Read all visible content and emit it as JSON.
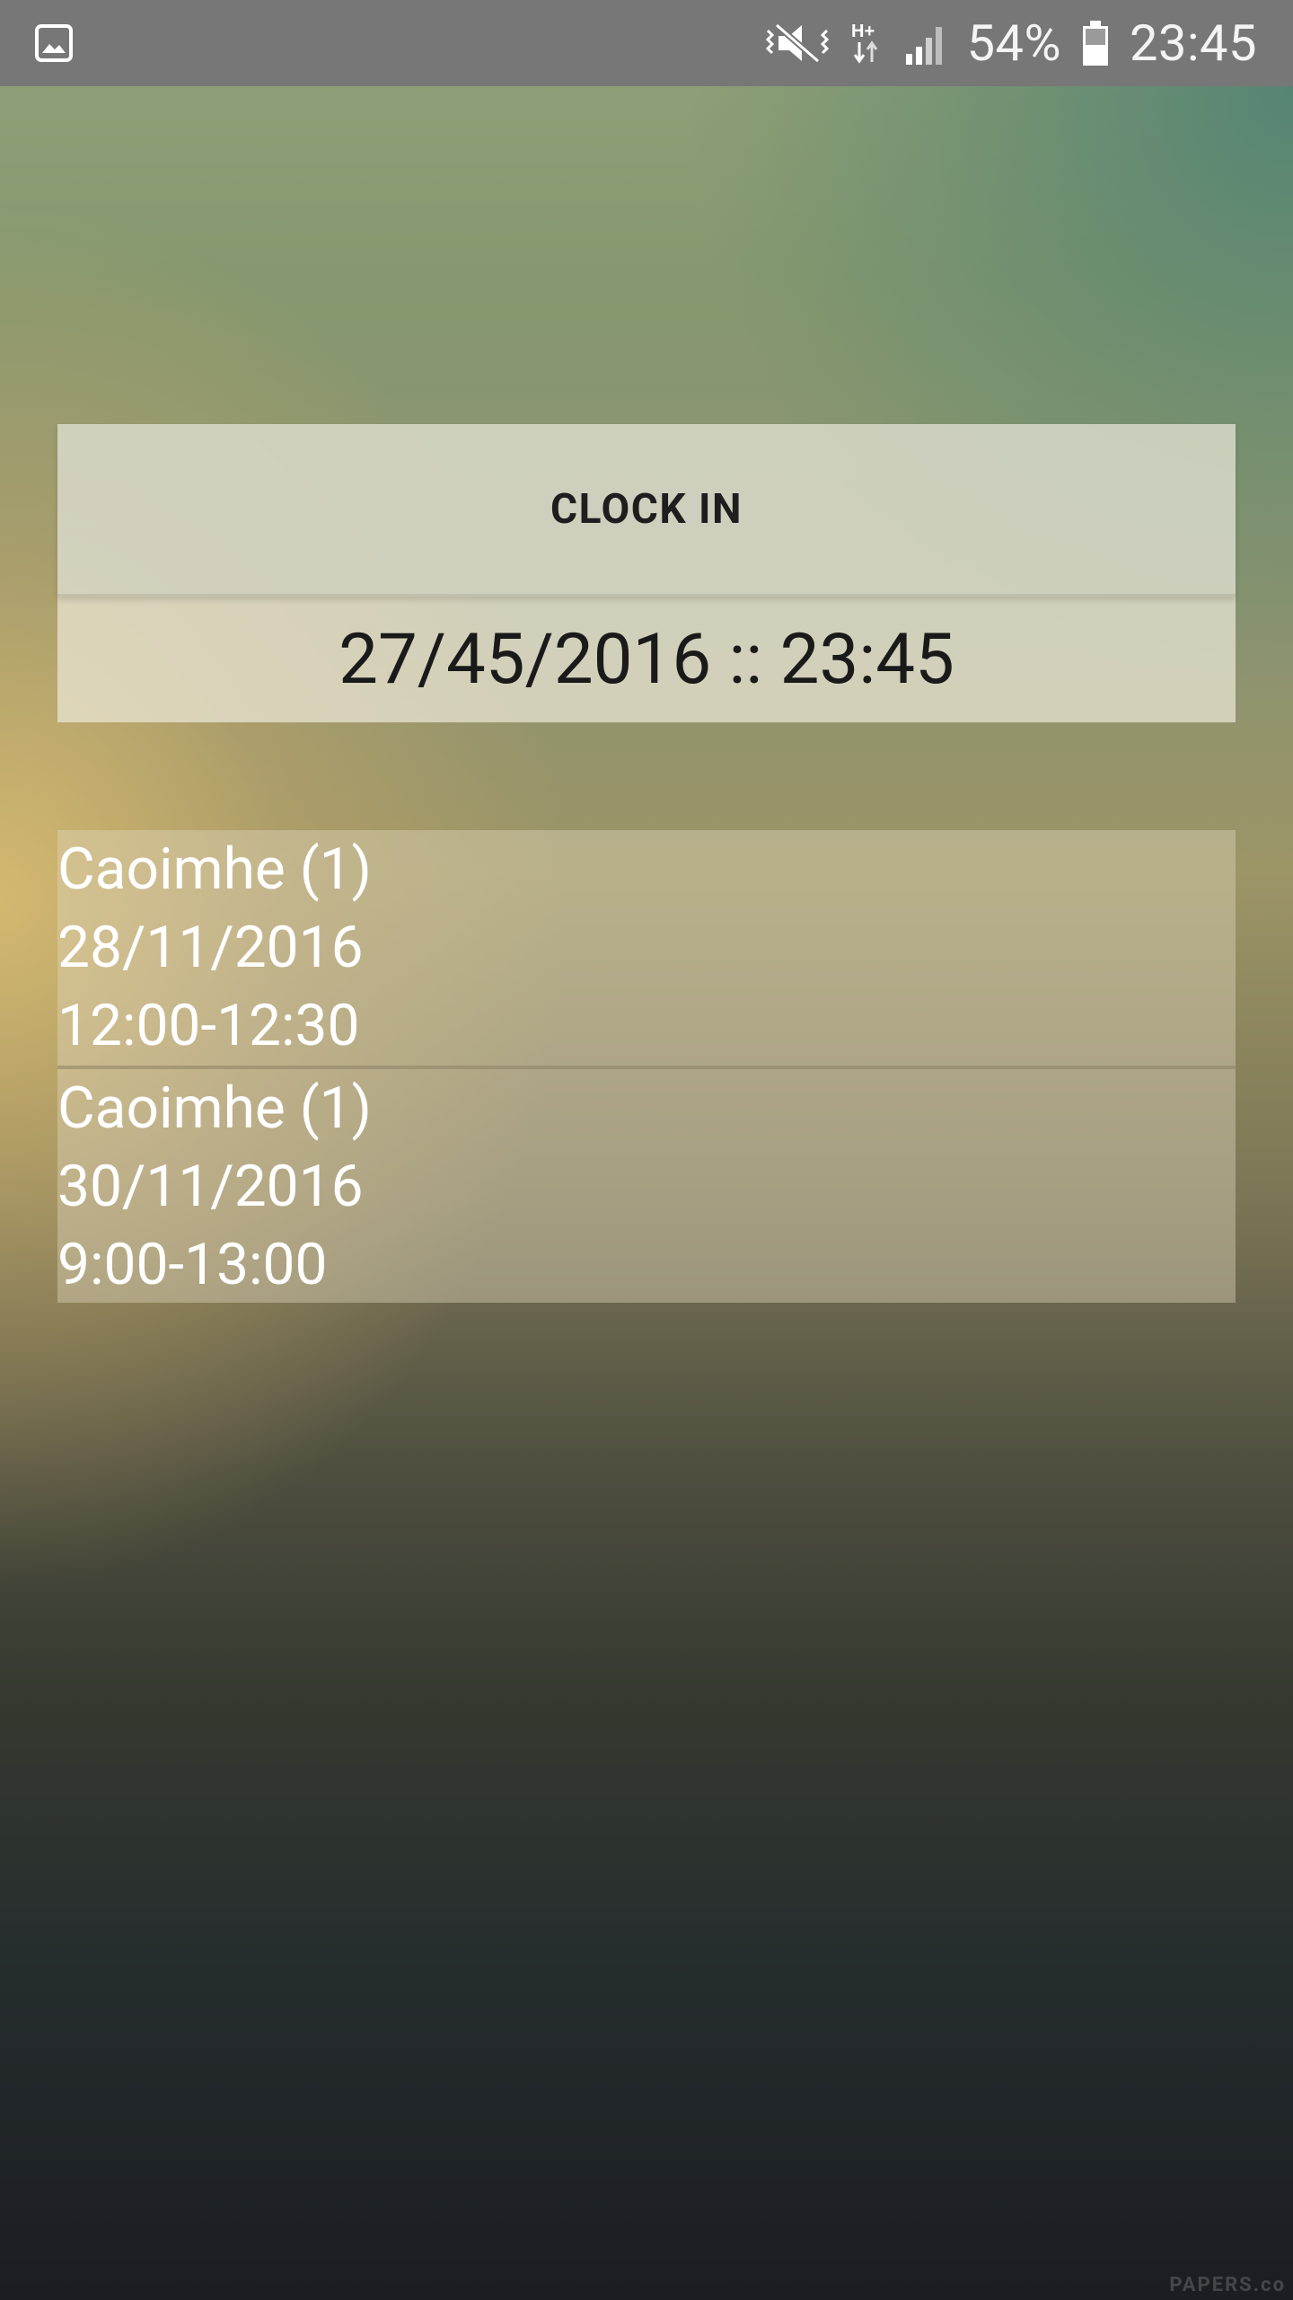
{
  "status_bar": {
    "battery_percent": "54%",
    "time": "23:45",
    "icons": [
      "image-icon",
      "vibrate-mute-icon",
      "network-hplus-icon",
      "signal-icon",
      "battery-icon"
    ]
  },
  "clock_card": {
    "button_label": "CLOCK IN",
    "datetime": "27/45/2016 :: 23:45"
  },
  "shifts": [
    {
      "name": "Caoimhe (1)",
      "date": "28/11/2016",
      "time": "12:00-12:30"
    },
    {
      "name": "Caoimhe (1)",
      "date": "30/11/2016",
      "time": "9:00-13:00"
    }
  ],
  "watermark": "PAPERS.co",
  "colors": {
    "status_bar_bg": "#777777",
    "text_dark": "#1a1a1a",
    "text_light": "#ffffff"
  }
}
